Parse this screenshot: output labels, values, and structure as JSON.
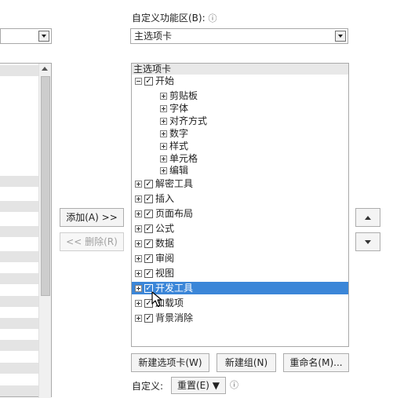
{
  "right_header": {
    "label": "自定义功能区(B):",
    "info_icon": "ⓘ"
  },
  "right_combo": {
    "value": "主选项卡"
  },
  "left_combo": {
    "value": ""
  },
  "tree": {
    "header": "主选项卡",
    "items": [
      {
        "label": "开始",
        "level": 0,
        "expander": "minus",
        "checked": true
      },
      {
        "label": "剪贴板",
        "level": 1,
        "expander": "plus",
        "checked": null
      },
      {
        "label": "字体",
        "level": 1,
        "expander": "plus",
        "checked": null
      },
      {
        "label": "对齐方式",
        "level": 1,
        "expander": "plus",
        "checked": null
      },
      {
        "label": "数字",
        "level": 1,
        "expander": "plus",
        "checked": null
      },
      {
        "label": "样式",
        "level": 1,
        "expander": "plus",
        "checked": null
      },
      {
        "label": "单元格",
        "level": 1,
        "expander": "plus",
        "checked": null
      },
      {
        "label": "编辑",
        "level": 1,
        "expander": "plus",
        "checked": null
      },
      {
        "label": "解密工具",
        "level": 0,
        "expander": "plus",
        "checked": true
      },
      {
        "label": "插入",
        "level": 0,
        "expander": "plus",
        "checked": true
      },
      {
        "label": "页面布局",
        "level": 0,
        "expander": "plus",
        "checked": true
      },
      {
        "label": "公式",
        "level": 0,
        "expander": "plus",
        "checked": true
      },
      {
        "label": "数据",
        "level": 0,
        "expander": "plus",
        "checked": true
      },
      {
        "label": "审阅",
        "level": 0,
        "expander": "plus",
        "checked": true
      },
      {
        "label": "视图",
        "level": 0,
        "expander": "plus",
        "checked": true
      },
      {
        "label": "开发工具",
        "level": 0,
        "expander": "plus",
        "checked": true,
        "selected": true
      },
      {
        "label": "加载项",
        "level": 0,
        "expander": "plus",
        "checked": true
      },
      {
        "label": "背景消除",
        "level": 0,
        "expander": "plus",
        "checked": true
      }
    ]
  },
  "buttons": {
    "add": "添加(A) >>",
    "remove": "<< 删除(R)",
    "new_tab": "新建选项卡(W)",
    "new_group": "新建组(N)",
    "rename": "重命名(M)...",
    "reset": "重置(E) ▼"
  },
  "customize": {
    "label": "自定义:",
    "info_icon": "ⓘ"
  },
  "colors": {
    "selection": "#3b86d8",
    "border": "#a9a9a9"
  }
}
